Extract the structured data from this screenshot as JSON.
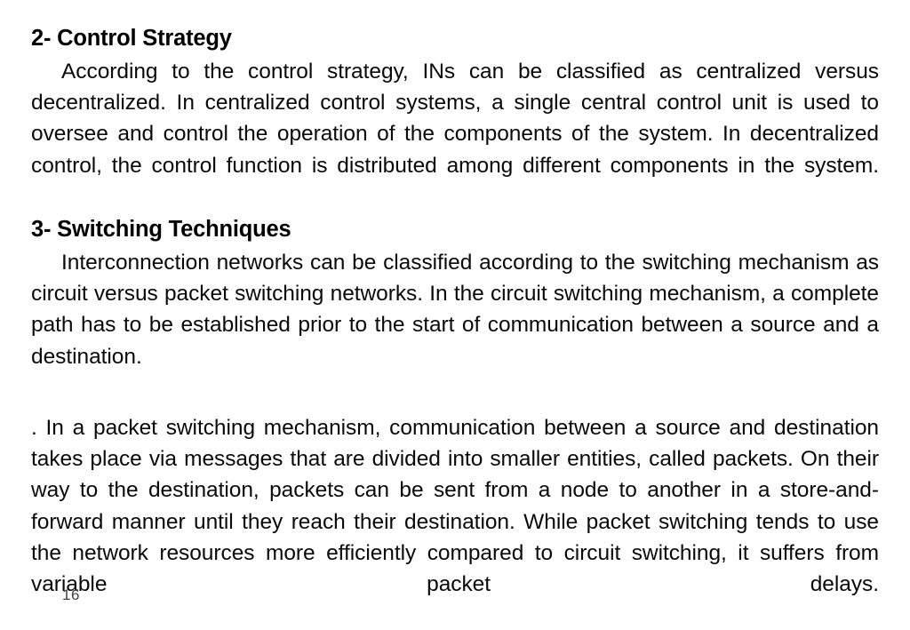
{
  "slide": {
    "background_color": "#ffffff",
    "text_color": "#0a0a0a",
    "page_number": "16",
    "page_number_color": "#3f4046",
    "headings": {
      "control_strategy": "2- Control Strategy",
      "switching_techniques": "3- Switching Techniques"
    },
    "paragraphs": {
      "control_strategy_body": "According to the control strategy, INs can be classified as centralized versus decentralized. In centralized control systems, a single central control unit is used to oversee and control the operation of the components of the system. In decentralized control, the control function is distributed among different components in the system.",
      "switching_circuit_body": "Interconnection networks can be classified according to the switching mechanism as circuit versus packet switching networks. In the circuit switching mechanism, a complete path has to be established prior to the start of communication between a source and a destination.",
      "switching_packet_body": ". In a packet switching mechanism, communication between a source and destination takes place via messages that are divided into smaller entities, called packets. On their way to the destination, packets can be sent from a node to another in a store-and-forward manner until they reach their destination. While packet switching tends to use the network resources more efficiently compared to circuit switching, it suffers from variable packet delays."
    }
  }
}
